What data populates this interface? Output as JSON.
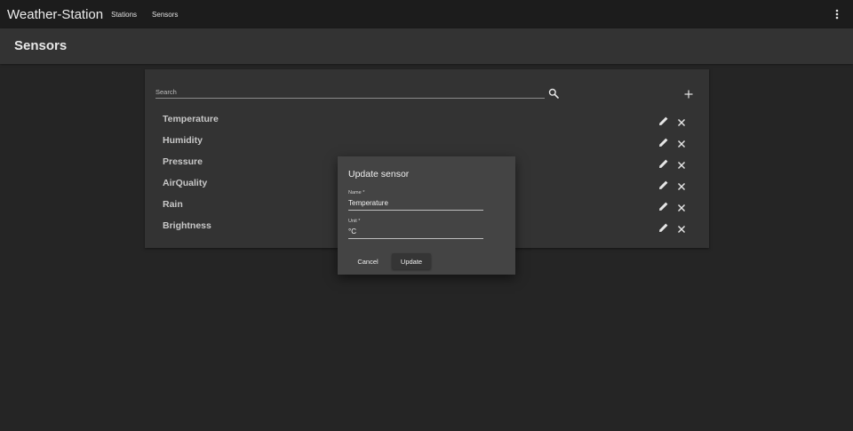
{
  "app": {
    "title": "Weather-Station"
  },
  "nav": {
    "items": [
      {
        "label": "Stations"
      },
      {
        "label": "Sensors"
      }
    ]
  },
  "page": {
    "title": "Sensors"
  },
  "search": {
    "placeholder": "Search",
    "value": ""
  },
  "sensors": [
    {
      "name": "Temperature"
    },
    {
      "name": "Humidity"
    },
    {
      "name": "Pressure"
    },
    {
      "name": "AirQuality"
    },
    {
      "name": "Rain"
    },
    {
      "name": "Brightness"
    }
  ],
  "dialog": {
    "title": "Update sensor",
    "name_label": "Name *",
    "name_value": "Temperature",
    "unit_label": "Unit *",
    "unit_value": "°C",
    "cancel_label": "Cancel",
    "update_label": "Update"
  },
  "icons": {
    "menu": "more-vert-icon",
    "search": "search-icon",
    "add": "plus-icon",
    "edit": "pencil-icon",
    "delete": "close-icon"
  },
  "colors": {
    "toolbar_bg": "#1c1c1c",
    "background": "#252525",
    "surface": "#333333",
    "dialog_bg": "#444444",
    "text": "#e6e6e6"
  }
}
